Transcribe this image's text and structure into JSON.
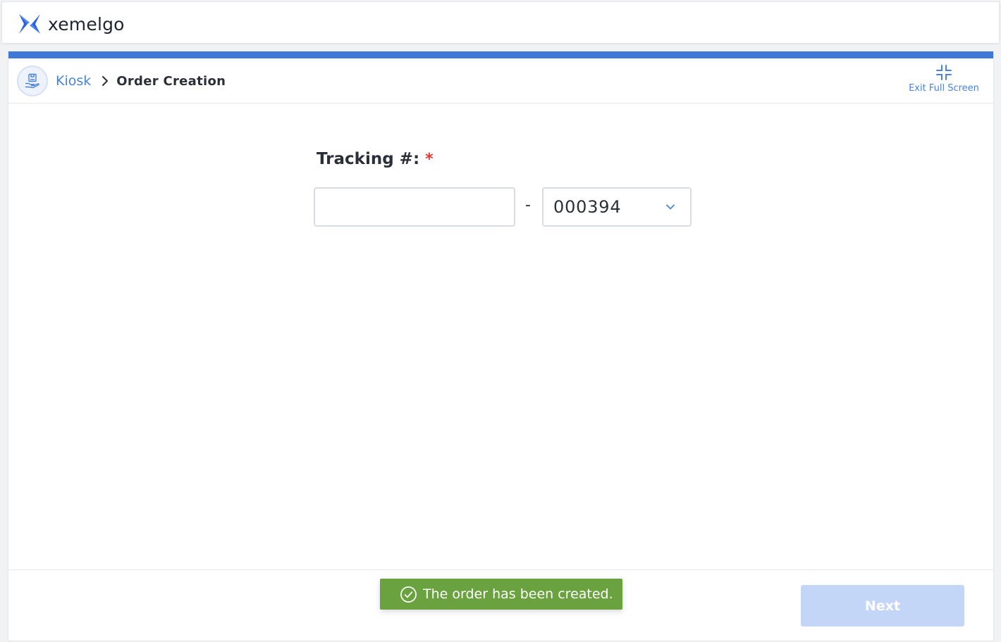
{
  "app": {
    "brand_name": "xemelgo",
    "brand_color": "#2b62e0",
    "logo_icon": "xemelgo-logo-icon"
  },
  "header": {
    "accent_color": "#3f78d6",
    "kiosk_icon": "kiosk-icon",
    "breadcrumb": {
      "root": "Kiosk",
      "separator_icon": "chevron-right-icon",
      "current": "Order Creation"
    },
    "exit_fullscreen": {
      "icon": "compress-icon",
      "label": "Exit Full Screen"
    }
  },
  "form": {
    "tracking_label": "Tracking #:",
    "required_marker": "*",
    "tracking_input": {
      "value": "",
      "placeholder": ""
    },
    "separator": "-",
    "suffix_select": {
      "selected": "000394",
      "icon": "chevron-down-icon"
    }
  },
  "footer": {
    "toast": {
      "message": "The order has been created.",
      "icon": "check-circle-icon",
      "color": "#6aa23f"
    },
    "next_label": "Next",
    "next_disabled": true
  }
}
